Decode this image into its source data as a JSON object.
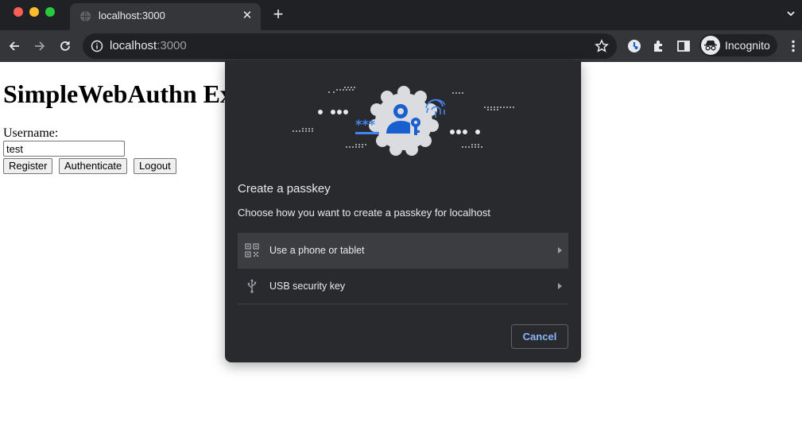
{
  "browser": {
    "tab": {
      "title": "localhost:3000",
      "close": "✕"
    },
    "new_tab": "+",
    "url_host": "localhost",
    "url_port": ":3000",
    "profile_label": "Incognito"
  },
  "page": {
    "heading": "SimpleWebAuthn Ex",
    "username_label": "Username:",
    "username_value": "test",
    "buttons": {
      "register": "Register",
      "authenticate": "Authenticate",
      "logout": "Logout"
    }
  },
  "dialog": {
    "title": "Create a passkey",
    "description": "Choose how you want to create a passkey for localhost",
    "options": [
      {
        "label": "Use a phone or tablet",
        "icon": "qr-code-icon"
      },
      {
        "label": "USB security key",
        "icon": "usb-icon"
      }
    ],
    "cancel_label": "Cancel"
  },
  "colors": {
    "dialog_bg": "#292a2d",
    "accent_blue": "#8ab4f8",
    "illustration_blue": "#1a5fd0",
    "tab_strip": "#202124",
    "toolbar": "#35363a"
  }
}
